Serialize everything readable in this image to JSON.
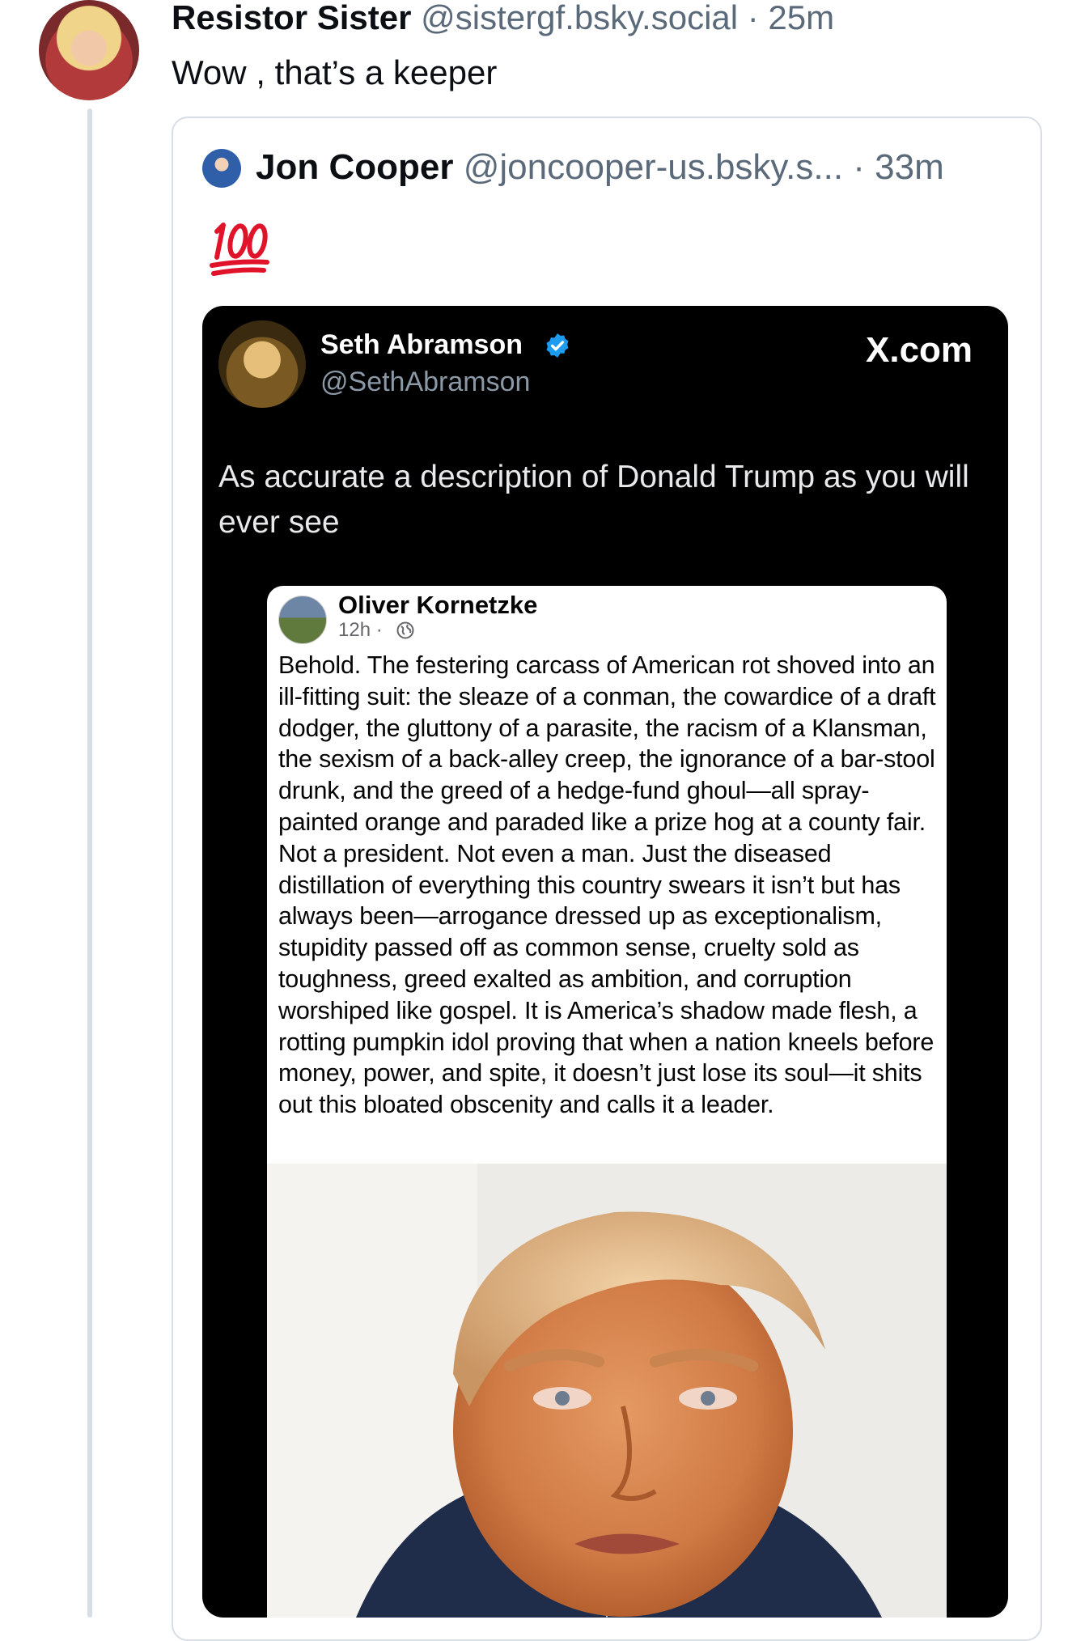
{
  "post": {
    "author_name": "Resistor Sister",
    "author_handle": "@sistergf.bsky.social",
    "time": "· 25m",
    "text": "Wow , that’s a keeper"
  },
  "quote": {
    "author_name": "Jon Cooper",
    "author_handle": "@joncooper-us.bsky.s...",
    "time": "· 33m",
    "emoji": "💯"
  },
  "embed": {
    "author_name": "Seth Abramson",
    "author_handle": "@SethAbramson",
    "site_label": "X.com",
    "text": "As accurate a description of Donald Trump as you will ever see",
    "fb_post": {
      "author_name": "Oliver Kornetzke",
      "meta": "12h ·",
      "text": "Behold. The festering carcass of American rot shoved into an ill-fitting suit: the sleaze of a conman, the cowardice of a draft dodger, the gluttony of a parasite, the racism of a Klansman, the sexism of a back-alley creep, the ignorance of a bar-stool drunk, and the greed of a hedge-fund ghoul—all spray-painted orange and paraded like a prize hog at a county fair. Not a president. Not even a man. Just the diseased distillation of everything this country swears it isn’t but has always been—arrogance dressed up as exceptionalism, stupidity passed off as common sense, cruelty sold as toughness, greed exalted as ambition, and corruption worshiped like gospel. It is America’s shadow made flesh, a rotting pumpkin idol proving that when a nation kneels before money, power, and spite, it doesn’t just lose its soul—it shits out this bloated obscenity and calls it a leader."
    }
  },
  "colors": {
    "muted": "#5b6a7a",
    "verified": "#1d9bf0",
    "hundred_red": "#e0132b"
  }
}
